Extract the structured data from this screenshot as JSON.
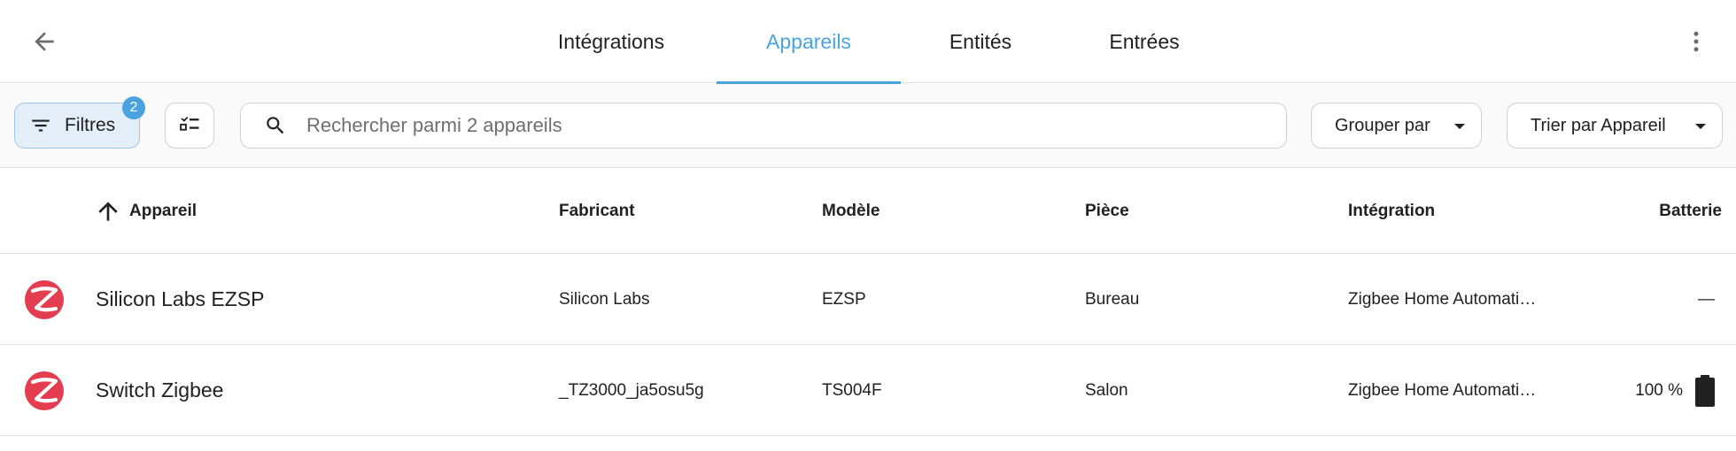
{
  "tabs": [
    {
      "label": "Intégrations",
      "active": false
    },
    {
      "label": "Appareils",
      "active": true
    },
    {
      "label": "Entités",
      "active": false
    },
    {
      "label": "Entrées",
      "active": false
    }
  ],
  "toolbar": {
    "filter_label": "Filtres",
    "filter_count": "2",
    "search_placeholder": "Rechercher parmi 2 appareils",
    "group_label": "Grouper par",
    "sort_label": "Trier par Appareil"
  },
  "table": {
    "headers": {
      "device": "Appareil",
      "manufacturer": "Fabricant",
      "model": "Modèle",
      "area": "Pièce",
      "integration": "Intégration",
      "battery": "Batterie"
    },
    "rows": [
      {
        "name": "Silicon Labs EZSP",
        "manufacturer": "Silicon Labs",
        "model": "EZSP",
        "area": "Bureau",
        "integration": "Zigbee Home Automati…",
        "battery": "—",
        "battery_level": null
      },
      {
        "name": "Switch Zigbee",
        "manufacturer": "_TZ3000_ja5osu5g",
        "model": "TS004F",
        "area": "Salon",
        "integration": "Zigbee Home Automati…",
        "battery": "100 %",
        "battery_level": 100
      }
    ]
  },
  "icons": {
    "back": "arrow-left-icon",
    "overflow": "dots-vertical-icon",
    "filter": "filter-variant-icon",
    "select": "checklist-icon",
    "search": "magnify-icon",
    "sort_direction": "arrow-up-icon",
    "device": "zigbee-icon",
    "battery": "battery-icon"
  },
  "colors": {
    "accent": "#4aa3df",
    "zigbee": "#e43d4f"
  }
}
